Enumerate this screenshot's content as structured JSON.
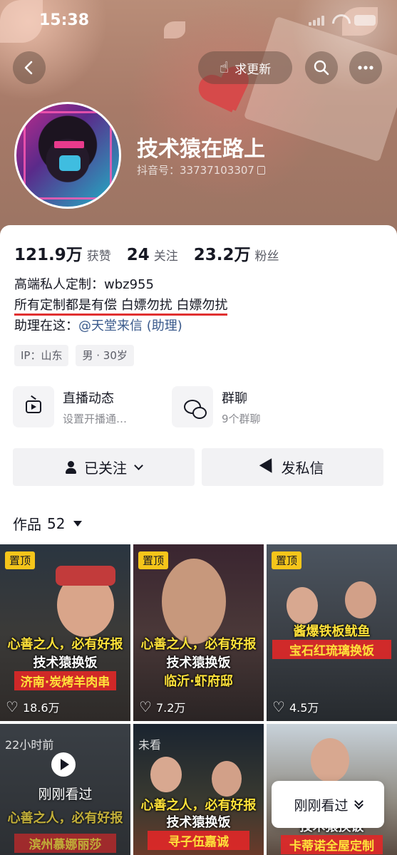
{
  "status_bar": {
    "time": "15:38"
  },
  "header": {
    "request_update_label": "求更新",
    "nickname": "技术猿在路上",
    "douyin_id": "抖音号：33737103307"
  },
  "stats": [
    {
      "value": "121.9万",
      "label": "获赞"
    },
    {
      "value": "24",
      "label": "关注"
    },
    {
      "value": "23.2万",
      "label": "粉丝"
    }
  ],
  "bio": {
    "line1": "高端私人定制：wbz955",
    "line2": "所有定制都是有偿 白嫖勿扰 白嫖勿扰",
    "line3_prefix": "助理在这：",
    "line3_mention": "@天堂来信 (助理)"
  },
  "tags": [
    "IP：山东",
    "男 · 30岁"
  ],
  "features": [
    {
      "title": "直播动态",
      "subtitle": "设置开播通…"
    },
    {
      "title": "群聊",
      "subtitle": "9个群聊"
    }
  ],
  "actions": {
    "follow_label": "已关注",
    "message_label": "发私信"
  },
  "works": {
    "label": "作品",
    "count": "52"
  },
  "videos": [
    {
      "pinned": "置顶",
      "cap1": "心善之人，必有好报",
      "cap2": "技术猿换饭",
      "cap3": "济南·炭烤羊肉串",
      "likes": "18.6万"
    },
    {
      "pinned": "置顶",
      "cap1": "心善之人，必有好报",
      "cap2": "技术猿换饭",
      "cap3": "临沂·虾府邸",
      "likes": "7.2万"
    },
    {
      "pinned": "置顶",
      "cap1": "酱爆铁板鱿鱼",
      "cap2": "宝石红琉璃换饭",
      "cap3": "",
      "likes": "4.5万"
    },
    {
      "time_label": "22小时前",
      "cap1": "心善之人，必有好报",
      "cap3": "滨州慕娜丽莎",
      "just_seen": "刚刚看过"
    },
    {
      "time_label": "未看",
      "cap1": "心善之人，必有好报",
      "cap2": "技术猿换饭",
      "cap3": "寻子伍嘉诚"
    },
    {
      "cap2": "技术猿换饭",
      "cap3": "卡蒂诺全屋定制"
    }
  ],
  "floating": {
    "just_seen_label": "刚刚看过"
  },
  "colors": {
    "accent_red": "#e03030",
    "pin_yellow": "#f5c51a",
    "mention_blue": "#3a5a8c"
  }
}
